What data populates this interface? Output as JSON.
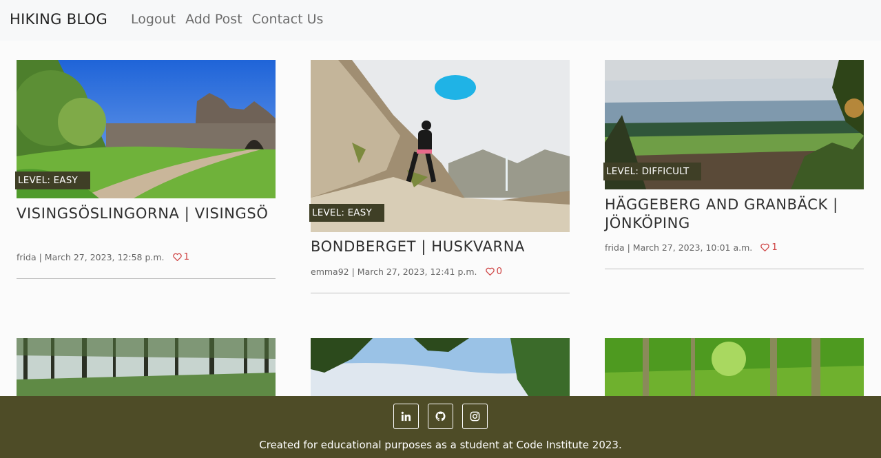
{
  "nav": {
    "brand": "HIKING BLOG",
    "links": [
      "Logout",
      "Add Post",
      "Contact Us"
    ]
  },
  "posts": [
    {
      "level": "LEVEL: EASY",
      "title": "VISINGSÖSLINGORNA | VISINGSÖ",
      "author": "frida",
      "date": "March 27, 2023, 12:58 p.m.",
      "likes": "1",
      "image": "castle-ruin-landscape"
    },
    {
      "level": "LEVEL: EASY",
      "title": "BONDBERGET | HUSKVARNA",
      "author": "emma92",
      "date": "March 27, 2023, 12:41 p.m.",
      "likes": "0",
      "image": "hiker-on-rocky-mountain"
    },
    {
      "level": "LEVEL: DIFFICULT",
      "title": "HÄGGEBERG AND GRANBÄCK | JÖNKÖPING",
      "author": "frida",
      "date": "March 27, 2023, 10:01 a.m.",
      "likes": "1",
      "image": "lake-valley-view"
    },
    {
      "image": "pine-forest"
    },
    {
      "image": "lakeside-trees"
    },
    {
      "image": "green-beech-forest"
    }
  ],
  "footer": {
    "social": [
      "linkedin-icon",
      "github-icon",
      "instagram-icon"
    ],
    "text": "Created for educational purposes as a student at Code Institute 2023."
  },
  "colors": {
    "badge": "#3f3f26",
    "footer": "#4e4c27",
    "like": "#cf4646"
  }
}
